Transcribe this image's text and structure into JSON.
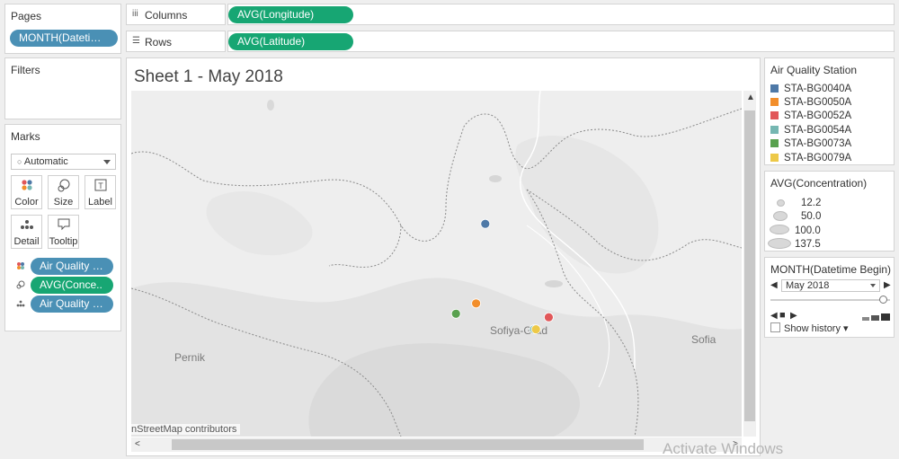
{
  "pages": {
    "title": "Pages",
    "pill": "MONTH(Datetime..."
  },
  "filters": {
    "title": "Filters"
  },
  "marks": {
    "title": "Marks",
    "mark_type": "Automatic",
    "buttons": [
      {
        "label": "Color",
        "icon": "color-palette-icon"
      },
      {
        "label": "Size",
        "icon": "size-shapes-icon"
      },
      {
        "label": "Label",
        "icon": "text-label-icon"
      },
      {
        "label": "Detail",
        "icon": "detail-dots-icon"
      },
      {
        "label": "Tooltip",
        "icon": "tooltip-bubble-icon"
      }
    ],
    "fields": [
      {
        "label": "Air Quality S..",
        "kind": "color",
        "color": "#4a90b5"
      },
      {
        "label": "AVG(Conce..",
        "kind": "size",
        "color": "#17a673"
      },
      {
        "label": "Air Quality S..",
        "kind": "detail",
        "color": "#4a90b5"
      }
    ]
  },
  "shelves": {
    "columns_label": "Columns",
    "columns_pill": "AVG(Longitude)",
    "rows_label": "Rows",
    "rows_pill": "AVG(Latitude)"
  },
  "sheet": {
    "title": "Sheet 1 - May 2018",
    "credit": "nStreetMap contributors",
    "places": {
      "pernik": "Pernik",
      "sofiya_grad": "Sofiya-Grad",
      "sofia": "Sofia"
    },
    "stations": [
      {
        "id": "STA-BG0040A",
        "lon_frac": 0.58,
        "lat_frac": 0.385,
        "color": "#4e79a7"
      },
      {
        "id": "STA-BG0050A",
        "lon_frac": 0.565,
        "lat_frac": 0.615,
        "color": "#f28e2b"
      },
      {
        "id": "STA-BG0052A",
        "lon_frac": 0.684,
        "lat_frac": 0.655,
        "color": "#e15759"
      },
      {
        "id": "STA-BG0054A",
        "lon_frac": 0.66,
        "lat_frac": 0.69,
        "color": "#76b7b2"
      },
      {
        "id": "STA-BG0073A",
        "lon_frac": 0.532,
        "lat_frac": 0.645,
        "color": "#59a14f"
      },
      {
        "id": "STA-BG0079A",
        "lon_frac": 0.663,
        "lat_frac": 0.69,
        "color": "#edc948"
      }
    ]
  },
  "legend_color": {
    "title": "Air Quality Station",
    "items": [
      {
        "label": "STA-BG0040A",
        "color": "#4e79a7"
      },
      {
        "label": "STA-BG0050A",
        "color": "#f28e2b"
      },
      {
        "label": "STA-BG0052A",
        "color": "#e15759"
      },
      {
        "label": "STA-BG0054A",
        "color": "#76b7b2"
      },
      {
        "label": "STA-BG0073A",
        "color": "#59a14f"
      },
      {
        "label": "STA-BG0079A",
        "color": "#edc948"
      }
    ]
  },
  "legend_size": {
    "title": "AVG(Concentration)",
    "items": [
      "12.2",
      "50.0",
      "100.0",
      "137.5"
    ]
  },
  "month_filter": {
    "title": "MONTH(Datetime Begin)",
    "selected": "May 2018",
    "show_history": "Show history",
    "slider_fraction": 0.95
  },
  "watermark": "Activate Windows"
}
